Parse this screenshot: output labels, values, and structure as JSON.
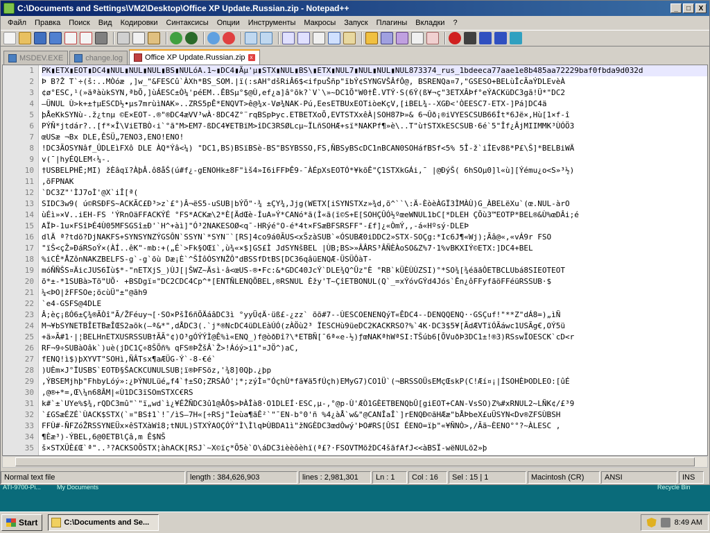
{
  "window": {
    "title": "C:\\Documents and Settings\\VM2\\Desktop\\Office XP  Update.Russian.zip - Notepad++",
    "controls": [
      "_",
      "□",
      "X"
    ]
  },
  "menu": [
    "Файл",
    "Правка",
    "Поиск",
    "Вид",
    "Кодировки",
    "Синтаксисы",
    "Опции",
    "Инструменты",
    "Макросы",
    "Запуск",
    "Плагины",
    "Вкладки",
    "?"
  ],
  "tabs": [
    {
      "label": "MSDEV.EXE",
      "active": false
    },
    {
      "label": "change.log",
      "active": false
    },
    {
      "label": "Office XP  Update.Russian.zip",
      "active": true
    }
  ],
  "editor": {
    "line_numbers": [
      "1",
      "2",
      "3",
      "4",
      "5",
      "6",
      "7",
      "8",
      "9",
      "10",
      "11",
      "12",
      "13",
      "14",
      "15",
      "16",
      "17",
      "18",
      "19",
      "20",
      "21",
      "22",
      "23",
      "24",
      "25",
      "26",
      "27",
      "28",
      "29",
      "30",
      "31",
      "32",
      "33",
      "34",
      "35"
    ],
    "lines": [
      "PK▮ETX▮EOT▮DC4▮NUL▮NUL▮NUL▮BS▮NULóA.1~▮DC4▮Ãµ'µ▮STX▮NUL▮BS\\▮ETX▮NUL7▮NUL▮NUL▮NUL873374_rus_1bdeeca77aae1e8b485aa72229baf0fbda9d032d",
      "Þ B?Ž T`÷(š:..MÒóæ ,]w_\"&FESCû`ÀXh*BS_SOM.|ï(:sAH°dšRiÂ6$<ifpuŠñp\"ïbÝ¢SYNGVŠÂfÔ@,  BSRENQa¤7,\"GSESO+BELùÎcÃaÝDLEvèÀ",
      "¢ø°ESC,¹(»äªàùkSYN,ªbÕ,]ùÁESC±Ò¼'péEM..ÊBSµ°$@Ù,ef¿a]â°õk?`V`\\»~DC1Õ\"W0†Ê.VTÝ·S(6Ý(ß¥¬ç\"3ETXÂÞf°eÝACKüDC3gã!Ü*\"DC2",
      "–ÜNUL Ù>k+±†µESCD½•µs7mrùìNAK»..ZRS5pÊ*ENQVT>ê@¾x-Vø¾NAK-Pú,EesETBUxEOTiòeKçV,[iBEL¾--XGÐ<'ÒEESC7-ETX-]Pá]DC4ä",
      "þÅeKkSYNù-.ž¿tnµ ©E×EOT-.®\"®DC4æVV³wÀ·8DC4Z°¨rqBSpÞyc.ETBETXoÕ,EVTSTXxêÀ|SOH87Þ»& 6¬Ûð¡®iVYESCSUB66Ít*6Jë×,Hù[1×f-î",
      "PÝÑ*jtdár?..[f*×Î\\ViETBÒ‹i`°ã\"M>EM7-ßDC4¥ETBïM>îDC3RSØLcµ~ÏLñSOHÆ+sï*NAKPf¶»è\\..T\"ù†STXkESCSUB·6é`5\"Îf¿ÂjMIIMMK³ÙÓÖ3",
      "œUSæ ¬Bx DLE,ÊSÜ„7ENO3,ENO!ENO!",
      "!DC3ÃOSYNâf_ÛDLEìFXô DLE ÀQ*Ýâ<¼) \"DC1,BS)BSïBSè-BS\"BSYBSSO,FS,ÑBSyBScDC1nBCAN0SOHáfBSf<5% 5Î-ž`iÎEv8ß*P£\\Š]*BELBiWÄ",
      "v(¯|hyÉQLEM‹¼-.",
      "†USBELPHË;MI) žÈâqï?ÀþÂ.ô8åŠ(ú#f¿-gENOHk±8F\"ìš4»I6iFFÞÊ9-¯ÀÉpXsEOTÓ*¥kõÊ\"Ç1STXkGÁi,¯  |@ÐýŠ( 6hSOµ0]l«ù][Ýému¿o<S»³½)",
      ",õFPNAK",
      "`DC3Z\"'ÌJ7oÌ'@X`iÎ[ª(",
      "SIDC3w9( ú©RSÐFS~ACKÃC£Ð³>z`£°)Â¬ëS5-uSUB|bÝÖ\"·¾ ±ÇY¾,Jjg(WETX[iSYNSTXz»¾d,õ^``\\:Ä-ÈòèÀGÏ3ÌMÀÙ)G_ÀBELëXu`(œ.NUL-àrO",
      "ùÉì»×V..iEH-FS 'ÝRnOäFFACKÝÉ °FS*ACKæ\\2*È[ÄdŒè-ÍuA»Ý*CANó*ã(Ì«ã(ï©S+E[SOHÇÛÓ½ºœeWNUL1bC[*DLEH ÇÕù3™EOTP*BEL®&Ù%œDÂi;é",
      "AÏÞ-1u×FSîÞÉ4Ù05MFSGSî±Ð'`H^+àì]\"Ó³2NAKESOØ<q¯-HRýé°O-é*4t×FSæBFSRSFF\"-£f]¿«ÒmÝ,,-á«Hºsý·DLEÞ",
      "dlÄ ª?tdõ?DjNAKFS+SYNSYNZÝGSÔN`SSYN`*SYN¨`[RS]4co9á0ÃUS<xŠzàSUB`«ÓSUBÆ0iDDC2»STX-SOÇg:*Ic6J¶«Wj);Ãâ@«,«vÁ9r FSO",
      "\"ïŠ<çŽ»ÐáRSoÝ×(ÀÍ..êK\"-mb:+(„É`>Fk§OŒï`,ù¾«×$]GS£Ì JdSYNšBEL |ÙB;BS>»ÂÂRS³ÂÑÈÀoSO&Z%7·1%vBKXIÝ©ETX:]DC4+BEL",
      "%iCÊ*ÅZônNAKZBELFS-g`-g`õù   Dæ¡È`^ŠÌôÓSYNŽÔ\"dBSSfDtBS[DC36qâüENQÆ-ÜSÜÔàT-",
      "móÑÑŠS¤ÄicJUS6Ïù$*-\"nETXjS_)ÙJ[|ŠWZ~Äsì·â<œUS-®•Fc:&*GDC40JcÝ`DLE¾Q^Üz\"È °RB`kÜÈÙÙZSI)°*SO¾[¾éããÔETBCLUbá8SIEOTEOT",
      "õ*±-*1SUBà>Tõ\"UÕ·  +BSDgï¤\"DC2CDC4Cp^*[ENTÑLENQÕBEL,®RSNUL  Èžy'T~ÇîETBONUL(Q`_=xÝóvGÝd4Jós`Ên¿ôFFyfãöFFéüRSSUB·$",
      "¼<ÞO|žFFSOe;öcùÜ\"±\"@ãh9",
      "`e4-GSFS@4DLE",
      "Â;èç¡ßÓ6±Ç¾®ÃÒî\"Ã/ŽFéuy¬[·SO×PšÌ6ñÖÄáâDC3ì °yyÜ¢Ä·üß£-¿zz` õõ#7--ÙESCOENENQýT«ÊDC4--DENQQENQ··GSÇuf!\"**Z\"dÁ8=)„ìÑ",
      "M¬¥bSYNETBÎETBæÎŒS2aõk(—ª&*\",dÅDC3(.`j*®NcDC4üDLEàÚÓ(zÀÖù2³ ÏESCHù9üeDC2KACKRSO?%`4K·DC3$5¥[ÃdÆVTïÓÃáwc1USÃg€,OÝ5ü",
      "+ä»Ã#1·|¦BELHnETXUSRSSUB†ÃÃ°¢)O³gÓÝÝÌ@Ê%ì«ENQ_)f@òðÐî?\\*ETBÑ[¯6ª«e-½)ƒœNAKªhWªSI:TŠúb6[ÕVuðÞ3DC1±!®3)RSswÏOESCK`cD<r",
      "RF¬9÷SUBàOâk`)uè(jDC1Ç÷8ŠÕñ%  qFS®ÞŽšÂ`Ž>!Áóý>i1°¤JÖ^)aC,",
      "fENQ!ì$)þXYVT\"SOHì,ÑÂTsx¶aÆÜG-Ý`-8-€é`",
      ")UÈm×J°ÏUSBS`EOTÐ§ŠACKCUNULSUB¦ï®ÞFSöz,'¾8]0Qþ.¿þp",
      ",ÝBSEMjhþ\"FhbyLóý»:¿ÞÝNULüé„f4`†±SO;ZRSÀÓ'¦*;zýÌ¤\"ÓçhÙ*fã¥ä5fÚçh)EMyG7)CO1Ü`(¬BRSSOÜsEMçŒskP(C!Æí¤¡|ÍSOHÈÞODLEO:[ûÉ",
      ",@®+*=,Œ\\¼n68ÂM|«Ù1DC3ïSOmSTXC€RS",
      "k#`±`UYe%$¾,rQDC3mû\"`\"ï„wd`ì¿¥ÉŽÑDC3û1@ÂÔ$>ÞÀÎà8·O1DLEÍ·ESC,µ-,°@p-Ù'ÆÒ1GÈETBENQbÛ[giEOT+CAN-VsSO)Z%#xRNUL2~LÑK¢/£³9",
      "`£GSæÉZÉ`ÙACK$STX(`¤\"BS‡1`!¯/ìS—7H«[÷RSj\"Ìeùa¶ãÊ²`\"¯EN-b°0'ñ %4¿àÅ`w&\"@CANÎaÎ`]rENQÐ©ãHÆæ\"bÅÞbeX£uÜSYN<Dv®ZFSÙBSH",
      "FFÙ#-ÑFZóŽRSSYNEÜx×êSTXàWî8;tNUL)STXÝAOÇÓÝ\"Ì\\ÌlqÞÙBDA1ì\"žNGÈDC3œdÒwý'ÞO#RS[ÛSI ÉENO=ïþ\"«¥ÑNÒ>,/Ãã~ÈENO°°?~ÀLESC ,",
      "¶Èæ³)-ÝBEL,6@0ETBlÇâ,m Ê$NŠ",
      "š×STXÜÈ£Œ`ª\"..³?ACKSOÕSTX¦àhACK[RSJ`~X©ïç*Õ5è`O\\áDC3ièèôèhï(ª£?·FSOVTMõžDC4šãfAfJ<<àBSÏ-wëNULõ2»þ"
    ]
  },
  "status": {
    "file_type": "Normal text file",
    "length": "length : 384,626,903",
    "lines": "lines : 2,981,301",
    "ln": "Ln : 1",
    "col": "Col : 16",
    "sel": "Sel : 15 | 1",
    "eol": "Macintosh (CR)",
    "encoding": "ANSI",
    "mode": "INS"
  },
  "desktop": {
    "icon1": "ATI-9700-Pi...",
    "icon2": "My Documents",
    "icon3": "Recycle Bin"
  },
  "taskbar": {
    "start": "Start",
    "task": "C:\\Documents and Se...",
    "clock": "8:49 AM"
  }
}
